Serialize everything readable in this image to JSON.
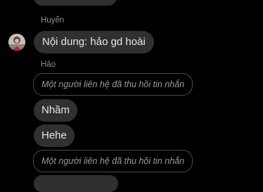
{
  "thread": {
    "top_partial_bubble": "",
    "group1": {
      "sender": "Huyến",
      "message": "Nội dung: hảo gd hoài"
    },
    "group2": {
      "sender": "Hảo",
      "recalled_1": "Một người liên hệ đã thu hồi tin nhắn",
      "message_1": "Nhầm",
      "message_2": "Hehe",
      "recalled_2": "Một người liên hệ đã thu hồi tin nhắn"
    }
  },
  "colors": {
    "background": "#000000",
    "bubble": "#303030",
    "text": "#e4e6eb",
    "muted": "#8d8d8d",
    "recalled_border": "#4a4a4a"
  }
}
